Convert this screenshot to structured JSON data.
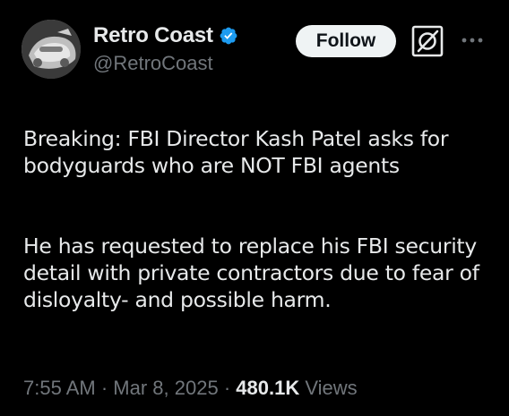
{
  "author": {
    "display_name": "Retro Coast",
    "handle": "@RetroCoast",
    "verified": true,
    "verified_color": "#1d9bf0"
  },
  "actions": {
    "follow_label": "Follow",
    "grok_icon": "grok-icon",
    "more_icon": "more-dots-icon"
  },
  "tweet": {
    "paragraphs": [
      "Breaking: FBI Director Kash Patel asks for bodyguards who are NOT FBI agents",
      "He has requested to replace his FBI security detail with private contractors due to fear of disloyalty- and possible harm."
    ]
  },
  "meta": {
    "time": "7:55 AM",
    "separator": "·",
    "date": "Mar 8, 2025",
    "views_count": "480.1K",
    "views_label": "Views"
  },
  "colors": {
    "background": "#000000",
    "primary_text": "#e7e9ea",
    "secondary_text": "#71767b",
    "follow_bg": "#eff3f4"
  }
}
